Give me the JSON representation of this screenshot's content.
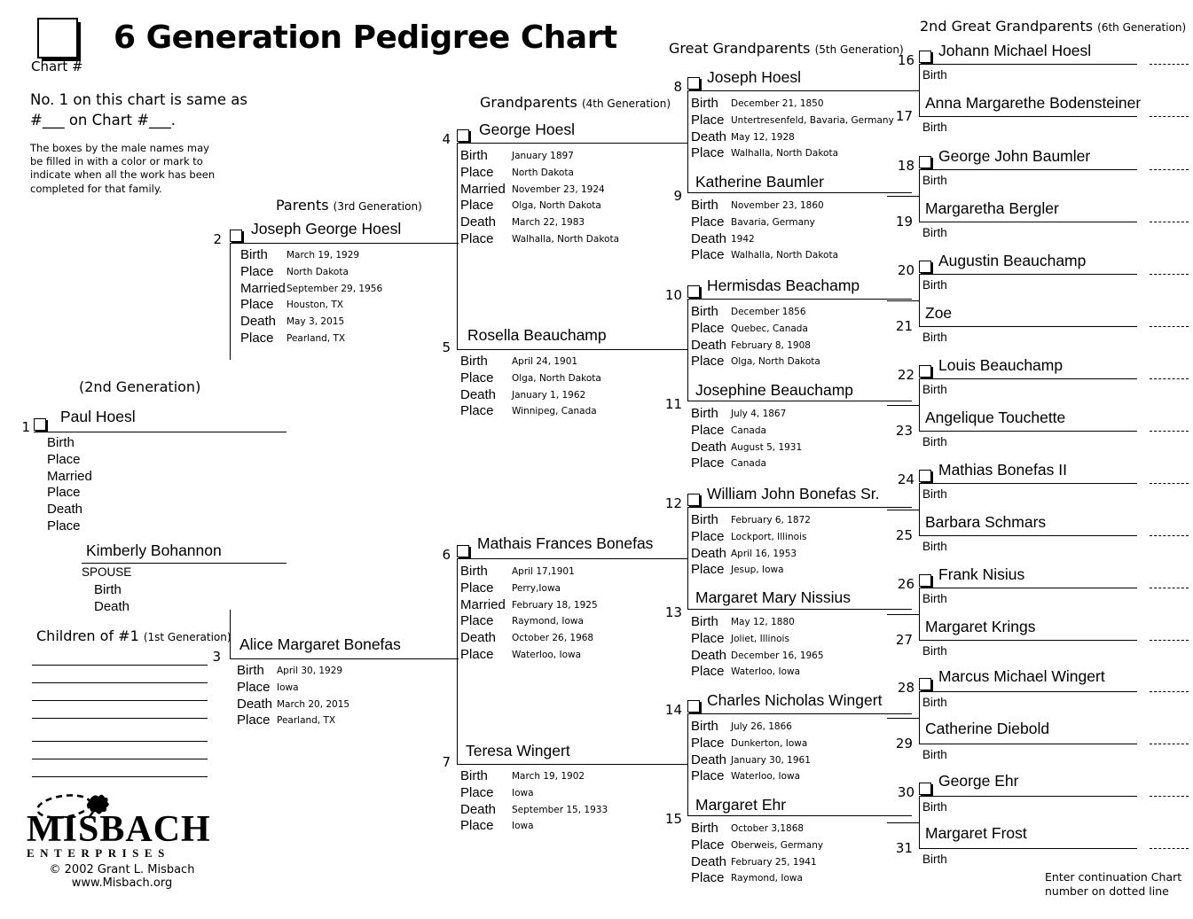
{
  "header": {
    "title": "6 Generation Pedigree Chart",
    "chart_hash_label": "Chart #",
    "same_as_note": "No. 1 on this chart is same as #___ on Chart #___.",
    "boxes_note": "The boxes by the male names may be filled in with a color or mark to indicate when all the work has been completed for that family."
  },
  "captions": {
    "gen2": "(2nd Generation)",
    "children": "Children of #1",
    "children_small": "(1st Generation)",
    "parents": "Parents",
    "parents_small": "(3rd Generation)",
    "grandparents": "Grandparents",
    "grandparents_small": "(4th Generation)",
    "great_grandparents": "Great Grandparents",
    "great_grandparents_small": "(5th Generation)",
    "second_great_grandparents": "2nd Great Grandparents",
    "second_great_grandparents_small": "(6th Generation)"
  },
  "labels": {
    "birth": "Birth",
    "place": "Place",
    "married": "Married",
    "death": "Death",
    "spouse": "SPOUSE"
  },
  "footer": {
    "wordmark": "MISBACH",
    "enterprises": "ENTERPRISES",
    "copyright": "© 2002 Grant L. Misbach",
    "website": "www.Misbach.org",
    "continuation_note": "Enter continuation Chart number on dotted line"
  },
  "people": {
    "p1": {
      "num": "1",
      "name": "Paul Hoesl",
      "birth": "",
      "birth_place": "",
      "married": "",
      "married_place": "",
      "death": "",
      "death_place": ""
    },
    "spouse": {
      "name": "Kimberly Bohannon",
      "birth": "",
      "death": ""
    },
    "p2": {
      "num": "2",
      "name": "Joseph George Hoesl",
      "birth": "March 19, 1929",
      "birth_place": "North Dakota",
      "married": "September 29, 1956",
      "married_place": "Houston, TX",
      "death": "May 3, 2015",
      "death_place": "Pearland, TX"
    },
    "p3": {
      "num": "3",
      "name": "Alice Margaret Bonefas",
      "birth": "April 30, 1929",
      "birth_place": "Iowa",
      "death": "March 20, 2015",
      "death_place": "Pearland, TX"
    },
    "p4": {
      "num": "4",
      "name": "George Hoesl",
      "birth": "January 1897",
      "birth_place": "North Dakota",
      "married": "November 23, 1924",
      "married_place": "Olga, North Dakota",
      "death": "March 22, 1983",
      "death_place": "Walhalla, North Dakota"
    },
    "p5": {
      "num": "5",
      "name": "Rosella Beauchamp",
      "birth": "April 24, 1901",
      "birth_place": "Olga, North Dakota",
      "death": "January 1, 1962",
      "death_place": "Winnipeg, Canada"
    },
    "p6": {
      "num": "6",
      "name": "Mathais Frances Bonefas",
      "birth": "April 17,1901",
      "birth_place": "Perry,Iowa",
      "married": "February 18, 1925",
      "married_place": "Raymond, Iowa",
      "death": "October 26, 1968",
      "death_place": "Waterloo, Iowa"
    },
    "p7": {
      "num": "7",
      "name": "Teresa Wingert",
      "birth": "March 19, 1902",
      "birth_place": "Iowa",
      "death": "September 15, 1933",
      "death_place": "Iowa"
    },
    "p8": {
      "num": "8",
      "name": "Joseph Hoesl",
      "birth": "December 21, 1850",
      "birth_place": "Untertresenfeld, Bavaria, Germany",
      "death": "May 12, 1928",
      "death_place": "Walhalla, North Dakota"
    },
    "p9": {
      "num": "9",
      "name": "Katherine Baumler",
      "birth": "November 23, 1860",
      "birth_place": "Bavaria, Germany",
      "death": "1942",
      "death_place": "Walhalla, North Dakota"
    },
    "p10": {
      "num": "10",
      "name": "Hermisdas Beachamp",
      "birth": "December 1856",
      "birth_place": "Quebec, Canada",
      "death": "February 8, 1908",
      "death_place": "Olga, North Dakota"
    },
    "p11": {
      "num": "11",
      "name": "Josephine Beauchamp",
      "birth": "July 4, 1867",
      "birth_place": "Canada",
      "death": "August 5, 1931",
      "death_place": "Canada"
    },
    "p12": {
      "num": "12",
      "name": "William John Bonefas Sr.",
      "birth": "February 6, 1872",
      "birth_place": "Lockport, Illinois",
      "death": "April 16, 1953",
      "death_place": "Jesup, Iowa"
    },
    "p13": {
      "num": "13",
      "name": "Margaret Mary Nissius",
      "birth": "May 12, 1880",
      "birth_place": "Joliet, Illinois",
      "death": "December 16, 1965",
      "death_place": "Waterloo, Iowa"
    },
    "p14": {
      "num": "14",
      "name": "Charles Nicholas Wingert",
      "birth": "July 26, 1866",
      "birth_place": "Dunkerton, Iowa",
      "death": "January 30, 1961",
      "death_place": "Waterloo, Iowa"
    },
    "p15": {
      "num": "15",
      "name": "Margaret Ehr",
      "birth": "October 3,1868",
      "birth_place": "Oberweis, Germany",
      "death": "February 25, 1941",
      "death_place": "Raymond, Iowa"
    },
    "p16": {
      "num": "16",
      "name": "Johann Michael Hoesl",
      "birth": ""
    },
    "p17": {
      "num": "17",
      "name": "Anna Margarethe Bodensteiner",
      "birth": ""
    },
    "p18": {
      "num": "18",
      "name": "George John Baumler",
      "birth": ""
    },
    "p19": {
      "num": "19",
      "name": "Margaretha Bergler",
      "birth": ""
    },
    "p20": {
      "num": "20",
      "name": "Augustin Beauchamp",
      "birth": ""
    },
    "p21": {
      "num": "21",
      "name": "Zoe",
      "birth": ""
    },
    "p22": {
      "num": "22",
      "name": "Louis Beauchamp",
      "birth": ""
    },
    "p23": {
      "num": "23",
      "name": "Angelique Touchette",
      "birth": ""
    },
    "p24": {
      "num": "24",
      "name": "Mathias Bonefas II",
      "birth": ""
    },
    "p25": {
      "num": "25",
      "name": "Barbara Schmars",
      "birth": ""
    },
    "p26": {
      "num": "26",
      "name": "Frank Nisius",
      "birth": ""
    },
    "p27": {
      "num": "27",
      "name": "Margaret Krings",
      "birth": ""
    },
    "p28": {
      "num": "28",
      "name": "Marcus Michael Wingert",
      "birth": ""
    },
    "p29": {
      "num": "29",
      "name": "Catherine Diebold",
      "birth": ""
    },
    "p30": {
      "num": "30",
      "name": "George Ehr",
      "birth": ""
    },
    "p31": {
      "num": "31",
      "name": "Margaret Frost",
      "birth": ""
    }
  }
}
